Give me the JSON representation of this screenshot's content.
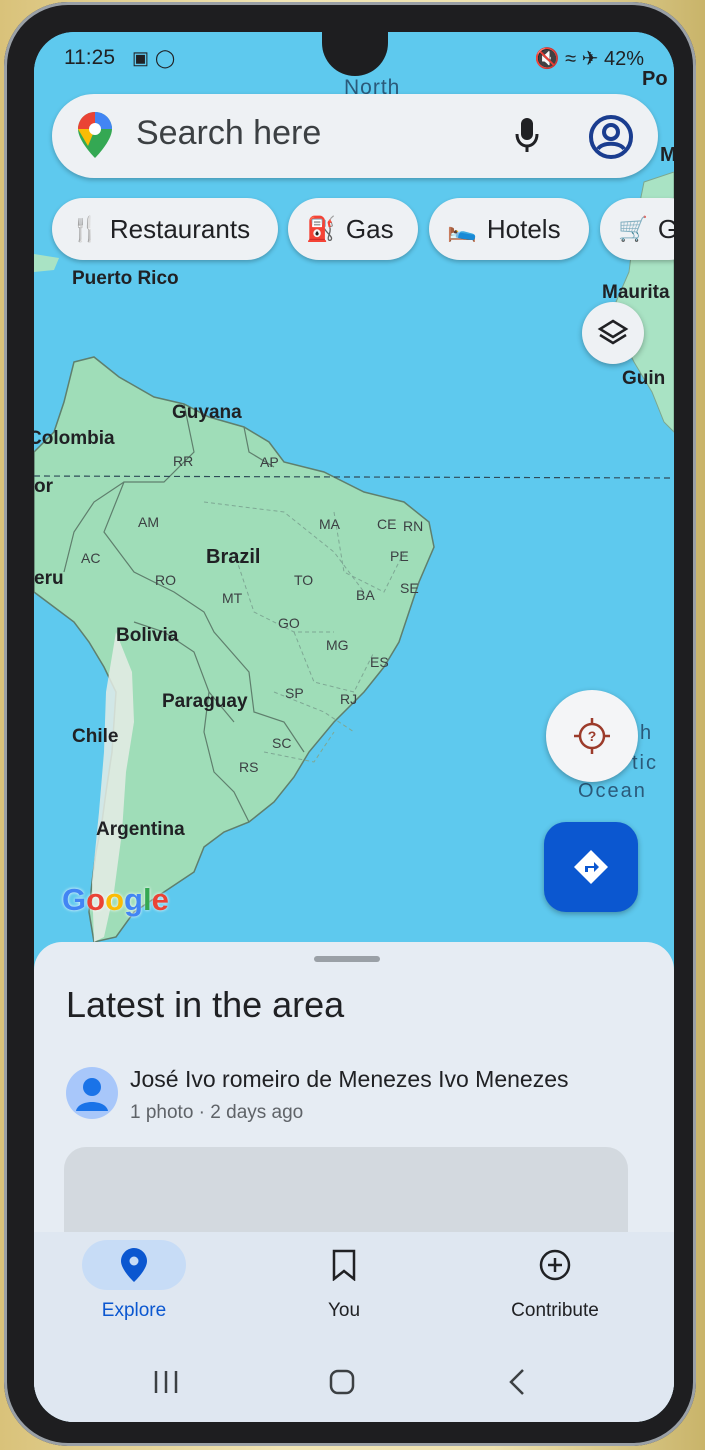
{
  "status_bar": {
    "time": "11:25",
    "battery": "42%"
  },
  "map": {
    "compass_label": "North",
    "ocean_label_line1": "h",
    "ocean_label_line2": "tic",
    "ocean_label_line3": "Ocean",
    "countries": [
      "Puerto Rico",
      "Guyana",
      "Colombia",
      "Brazil",
      "Bolivia",
      "Paraguay",
      "Chile",
      "Argentina"
    ],
    "edge_labels": [
      "Po",
      "M",
      "Maurita",
      "Guin",
      "or",
      "eru"
    ],
    "state_codes": [
      "RR",
      "AP",
      "AM",
      "MA",
      "CE",
      "RN",
      "PE",
      "AC",
      "RO",
      "MT",
      "TO",
      "BA",
      "SE",
      "GO",
      "MG",
      "ES",
      "SP",
      "RJ",
      "SC",
      "RS"
    ],
    "logo_text": "Google"
  },
  "search": {
    "placeholder": "Search here"
  },
  "chips": [
    {
      "label": "Restaurants",
      "icon": "restaurant-icon"
    },
    {
      "label": "Gas",
      "icon": "gas-station-icon"
    },
    {
      "label": "Hotels",
      "icon": "hotel-icon"
    },
    {
      "label": "G",
      "icon": "groceries-cart-icon"
    }
  ],
  "sheet": {
    "title": "Latest in the area",
    "post": {
      "author": "José Ivo romeiro de Menezes Ivo Menezes",
      "meta": "1 photo · 2 days ago"
    }
  },
  "bottom_nav": {
    "explore": "Explore",
    "you": "You",
    "contribute": "Contribute"
  },
  "colors": {
    "water": "#5ec9ee",
    "land": "#9fddb8",
    "accent": "#0b57d0"
  }
}
